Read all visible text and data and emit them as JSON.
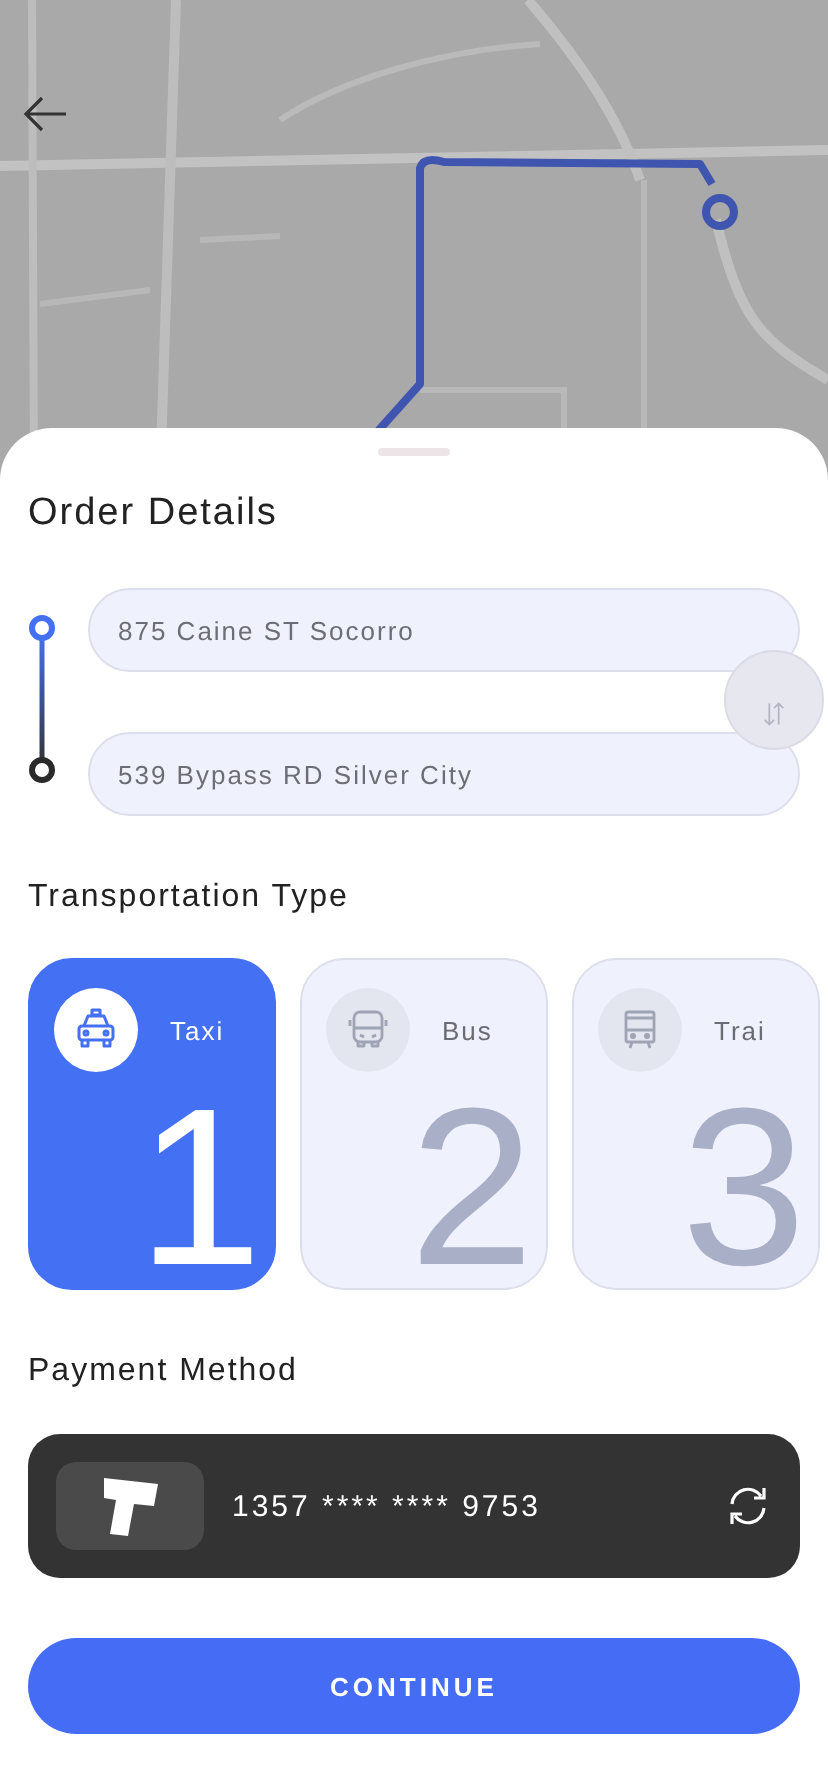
{
  "sheet": {
    "title": "Order Details",
    "route": {
      "from": "875 Caine ST Socorro",
      "to": "539 Bypass RD Silver City"
    },
    "transport": {
      "title": "Transportation Type",
      "options": [
        {
          "kind": "taxi",
          "label": "Taxi",
          "number": "1",
          "selected": true
        },
        {
          "kind": "bus",
          "label": "Bus",
          "number": "2",
          "selected": false
        },
        {
          "kind": "train",
          "label": "Trai",
          "number": "3",
          "selected": false
        }
      ]
    },
    "payment": {
      "title": "Payment Method",
      "card_number": "1357 **** **** 9753"
    },
    "button": "CONTINUE"
  }
}
